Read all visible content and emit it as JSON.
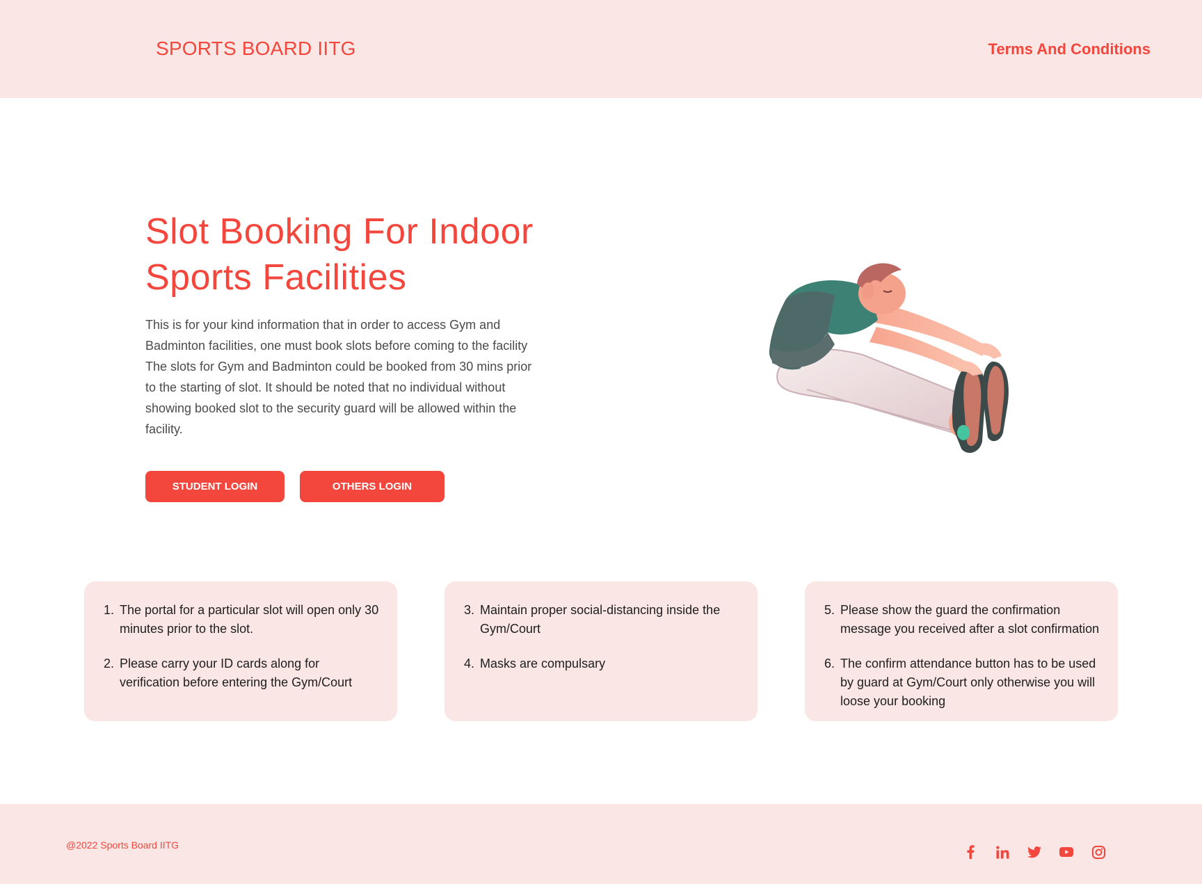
{
  "header": {
    "brand": "SPORTS BOARD IITG",
    "terms_link": "Terms And Conditions"
  },
  "hero": {
    "title": "Slot Booking For Indoor Sports Facilities",
    "description": "This is for your kind information that in order to access Gym and Badminton facilities, one must book slots before coming to the facility The slots for Gym and Badminton could be booked from 30 mins prior to the starting of slot. It should be noted that no individual without showing booked slot to the security guard will be allowed within the facility.",
    "student_login_label": "STUDENT LOGIN",
    "others_login_label": "OTHERS LOGIN"
  },
  "rules": [
    {
      "items": [
        {
          "num": "1.",
          "text": "The portal for a particular slot will open only 30 minutes prior to the slot."
        },
        {
          "num": "2.",
          "text": "Please carry your ID cards along for verification before entering the Gym/Court"
        }
      ]
    },
    {
      "items": [
        {
          "num": "3.",
          "text": "Maintain proper social-distancing inside the Gym/Court"
        },
        {
          "num": "4.",
          "text": "Masks are compulsary"
        }
      ]
    },
    {
      "items": [
        {
          "num": "5.",
          "text": "Please show the guard the confirmation message you received after a slot confirmation"
        },
        {
          "num": "6.",
          "text": "The confirm attendance button has to be used by guard at Gym/Court only otherwise you will loose your booking"
        }
      ]
    }
  ],
  "footer": {
    "copyright": "@2022 Sports Board IITG",
    "socials": [
      "facebook-icon",
      "linkedin-icon",
      "twitter-icon",
      "youtube-icon",
      "instagram-icon"
    ]
  },
  "colors": {
    "accent": "#f3463c",
    "panel": "#fae6e5",
    "text": "#4a4a4a"
  }
}
